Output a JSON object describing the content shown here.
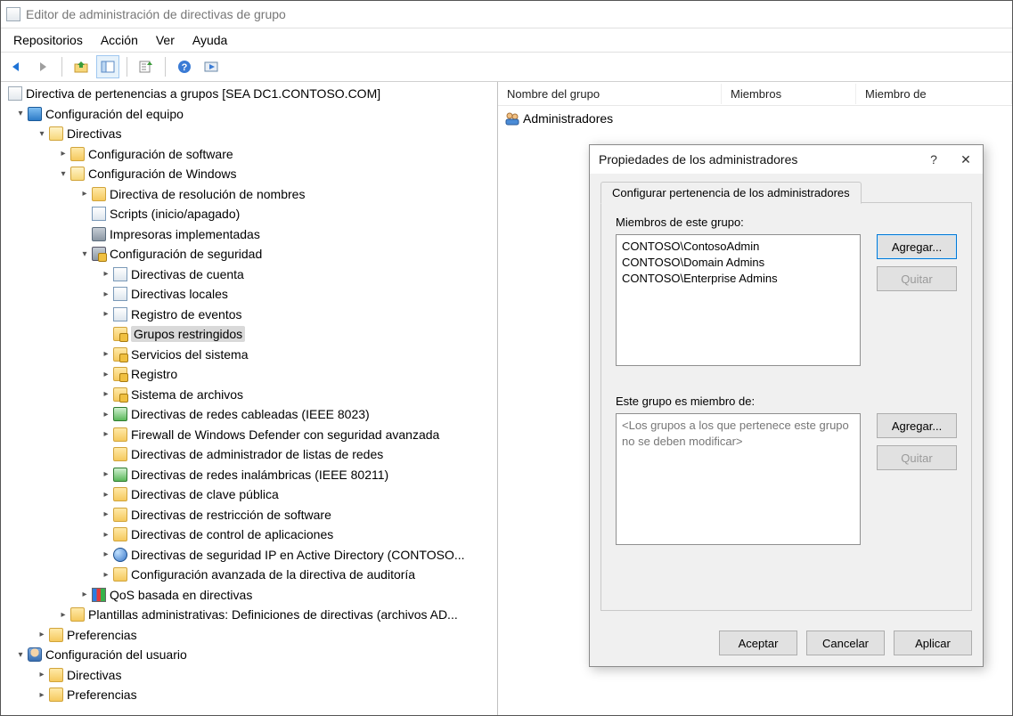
{
  "window": {
    "title": "Editor de administración de directivas de grupo"
  },
  "menu": {
    "items": [
      "Repositorios",
      "Acción",
      "Ver",
      "Ayuda"
    ]
  },
  "toolbar": {
    "back": "back-icon",
    "forward": "forward-icon",
    "up": "up-icon",
    "tree": "tree-icon",
    "refresh": "refresh-icon",
    "export": "export-icon",
    "help": "help-icon",
    "play": "play-icon"
  },
  "tree": {
    "root": "Directiva de pertenencias a grupos [SEA DC1.CONTOSO.COM]",
    "computer_config": "Configuración del equipo",
    "directivas": "Directivas",
    "config_software": "Configuración de software",
    "config_windows": "Configuración de Windows",
    "dns": "Directiva de resolución de nombres",
    "scripts": "Scripts (inicio/apagado)",
    "printers": "Impresoras implementadas",
    "security": "Configuración de seguridad",
    "sec_account": "Directivas de cuenta",
    "sec_local": "Directivas locales",
    "sec_eventlog": "Registro de eventos",
    "sec_restricted": "Grupos restringidos",
    "sec_services": "Servicios del sistema",
    "sec_registry": "Registro",
    "sec_filesystem": "Sistema de archivos",
    "sec_wired": "Directivas de redes cableadas (IEEE 8023)",
    "sec_firewall": "Firewall de Windows Defender con seguridad avanzada",
    "sec_netlist": "Directivas de administrador de listas de redes",
    "sec_wireless": "Directivas de redes inalámbricas (IEEE 80211)",
    "sec_pubkey": "Directivas de clave pública",
    "sec_softrestrict": "Directivas de restricción de software",
    "sec_appcontrol": "Directivas de control de aplicaciones",
    "sec_ipsec": "Directivas de seguridad IP en Active Directory (CONTOSO...",
    "sec_audit": "Configuración avanzada de la directiva de auditoría",
    "qos": "QoS basada en directivas",
    "admin_templates": "Plantillas administrativas: Definiciones de directivas (archivos AD...",
    "preferences_c": "Preferencias",
    "user_config": "Configuración del usuario",
    "directivas_u": "Directivas",
    "preferences_u": "Preferencias"
  },
  "content": {
    "columns": {
      "c1": "Nombre del grupo",
      "c2": "Miembros",
      "c3": "Miembro de"
    },
    "row1": "Administradores"
  },
  "dialog": {
    "title": "Propiedades de los administradores",
    "help": "?",
    "close": "✕",
    "tab": "Configurar pertenencia de los administradores",
    "members_label": "Miembros de este grupo:",
    "members": [
      "CONTOSO\\ContosoAdmin",
      "CONTOSO\\Domain Admins",
      "CONTOSO\\Enterprise Admins"
    ],
    "memberof_label": "Este grupo es miembro de:",
    "memberof_placeholder": "<Los grupos a los que pertenece este grupo no se deben modificar>",
    "btn_add": "Agregar...",
    "btn_remove": "Quitar",
    "btn_ok": "Aceptar",
    "btn_cancel": "Cancelar",
    "btn_apply": "Aplicar"
  }
}
